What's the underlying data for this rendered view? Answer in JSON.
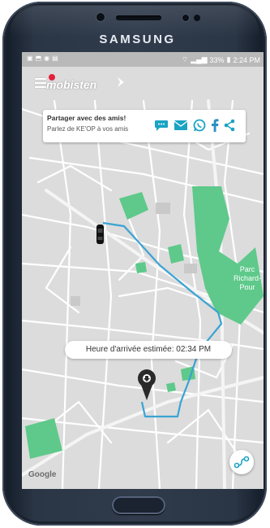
{
  "device": {
    "brand": "SAMSUNG"
  },
  "statusbar": {
    "battery_text": "33%",
    "time": "2:24 PM"
  },
  "app": {
    "logo_text": "mobisten"
  },
  "share_card": {
    "title": "Partager avec des amis!",
    "subtitle": "Parlez de KE'OP à vos amis",
    "icons": [
      "sms-icon",
      "email-icon",
      "whatsapp-icon",
      "facebook-icon",
      "share-icon"
    ]
  },
  "map": {
    "park_label_line1": "Parc",
    "park_label_line2": "Richard-Pour",
    "google_label": "Google",
    "route_color": "#3aa3d3",
    "park_color": "#5ec98a"
  },
  "eta": {
    "text": "Heure d'arrivée estimée: 02:34 PM"
  },
  "colors": {
    "accent_teal": "#1aa3c3",
    "logo_red": "#e4213a",
    "facebook_blue": "#2d8fc1"
  }
}
